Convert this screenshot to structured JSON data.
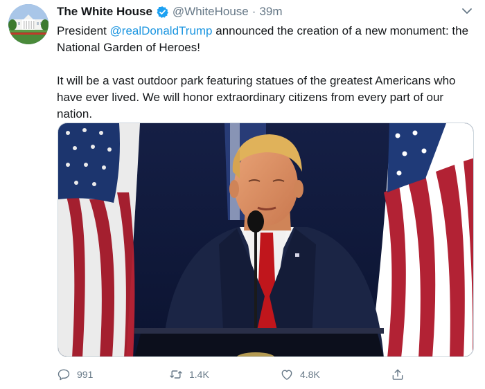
{
  "tweet": {
    "display_name": "The White House",
    "handle": "@WhiteHouse",
    "separator": "·",
    "time": "39m",
    "text_line1_prefix": "President ",
    "mention": "@realDonaldTrump",
    "text_line1_suffix": " announced the creation of a new monument: the National Garden of Heroes!",
    "text_paragraph2": "It will be a vast outdoor park featuring statues of the greatest Americans who have ever lived. We will honor extraordinary citizens from every part of our nation."
  },
  "actions": {
    "reply_count": "991",
    "retweet_count": "1.4K",
    "like_count": "4.8K"
  },
  "icons": {
    "verified": "verified-badge-icon",
    "caret": "chevron-down-icon",
    "reply": "reply-icon",
    "retweet": "retweet-icon",
    "like": "heart-icon",
    "share": "share-icon"
  },
  "colors": {
    "mention": "#1b95e0",
    "verified": "#1da1f2",
    "secondary_text": "#657786"
  }
}
